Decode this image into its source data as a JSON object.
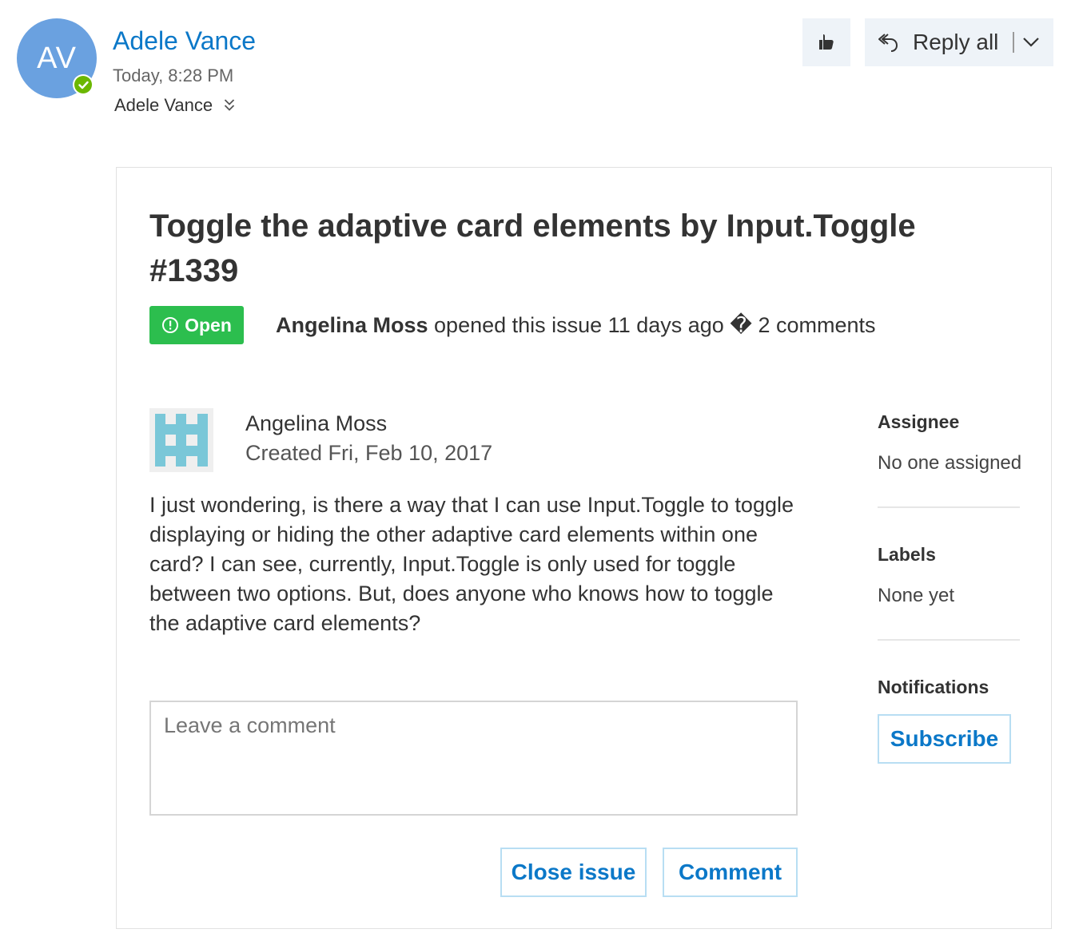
{
  "header": {
    "avatar_initials": "AV",
    "avatar_color": "#6aa1e0",
    "presence_status": "available",
    "sender_name": "Adele Vance",
    "sent_time": "Today, 8:28 PM",
    "recipient": "Adele Vance",
    "like_icon": "like-icon",
    "reply_all_label": "Reply all"
  },
  "card": {
    "title": "Toggle the adaptive card elements by Input.Toggle #1339",
    "status_label": "Open",
    "status_color": "#2cbe4e",
    "meta_author": "Angelina Moss",
    "meta_text": " opened this issue 11 days ago � 2 comments",
    "comment": {
      "author": "Angelina Moss",
      "created": "Created Fri, Feb 10, 2017",
      "body": "I just wondering, is there a way that I can use Input.Toggle to toggle displaying or hiding the other adaptive card elements within one card? I can see, currently, Input.Toggle is only used for toggle between two options. But, does anyone who knows how to toggle the adaptive card elements?"
    },
    "comment_placeholder": "Leave a comment",
    "close_issue_label": "Close issue",
    "comment_button_label": "Comment",
    "sidebar": {
      "assignee_heading": "Assignee",
      "assignee_value": "No one assigned",
      "labels_heading": "Labels",
      "labels_value": "None yet",
      "notifications_heading": "Notifications",
      "subscribe_label": "Subscribe"
    },
    "link_color": "#0b78c8"
  }
}
